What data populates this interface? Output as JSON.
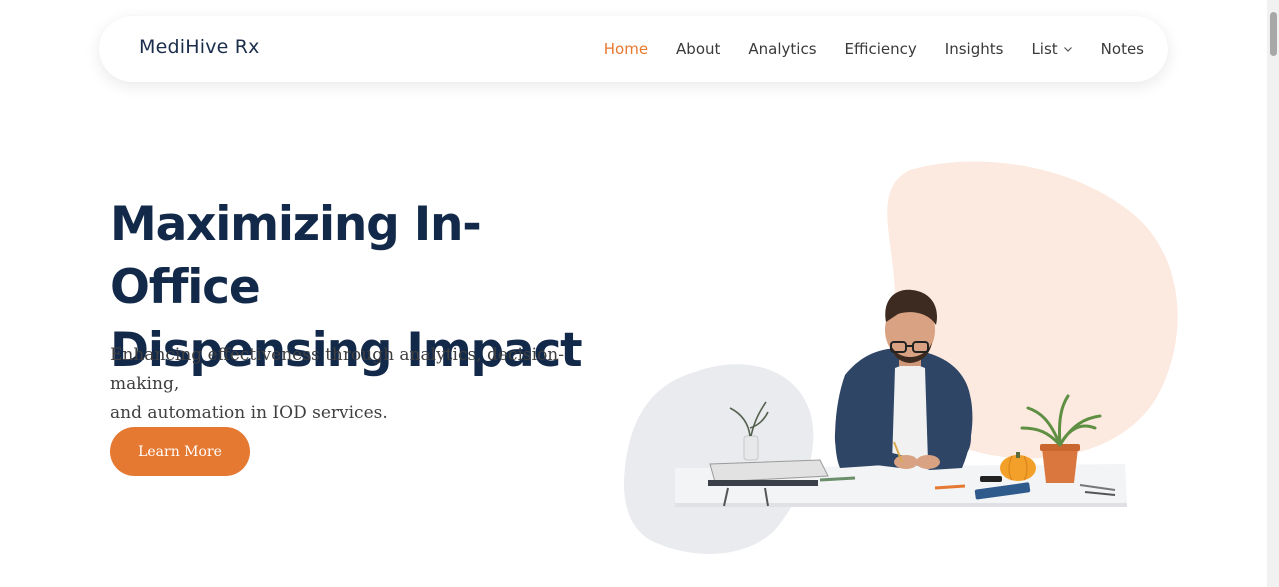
{
  "brand": "MediHive Rx",
  "nav": {
    "items": [
      {
        "label": "Home",
        "active": true
      },
      {
        "label": "About"
      },
      {
        "label": "Analytics"
      },
      {
        "label": "Efficiency"
      },
      {
        "label": "Insights"
      },
      {
        "label": "List",
        "has_dropdown": true
      },
      {
        "label": "Notes"
      }
    ]
  },
  "hero": {
    "title_line1": "Maximizing In-Office",
    "title_line2": "Dispensing Impact",
    "subtitle_line1": "Enhancing effectiveness through analytics, decision-making,",
    "subtitle_line2": "and automation in IOD services.",
    "cta_label": "Learn More"
  },
  "colors": {
    "accent": "#e57932",
    "heading": "#13294a",
    "blob_peach": "#fce9df",
    "blob_gray": "#e9ebee"
  },
  "icons": {
    "dropdown": "chevron-down-icon"
  }
}
